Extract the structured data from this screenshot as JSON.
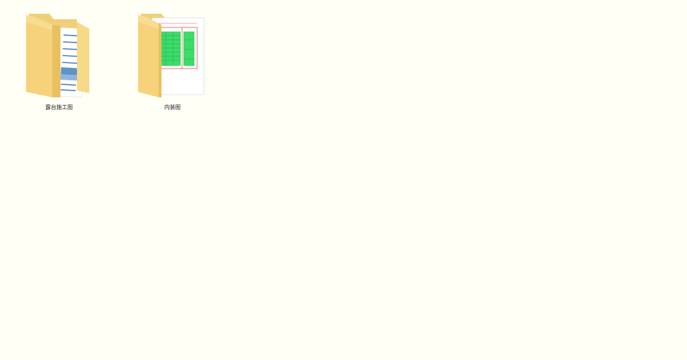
{
  "desktop": {
    "background_color": "#fffff6",
    "folders": [
      {
        "label": "露台施工图",
        "icon": "folder-with-document-icon"
      },
      {
        "label": "内装图",
        "icon": "folder-with-drawing-icon"
      }
    ]
  }
}
